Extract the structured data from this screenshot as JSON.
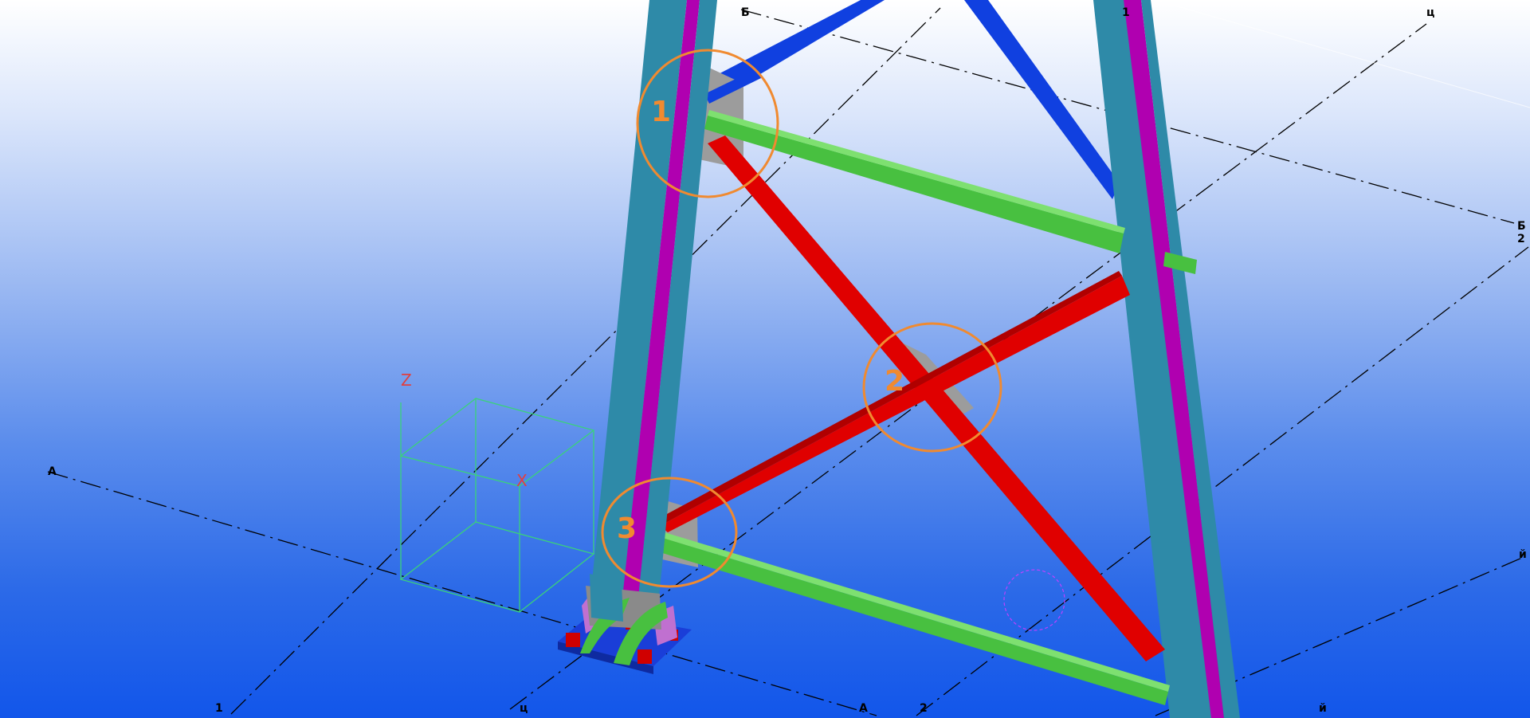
{
  "colors": {
    "background_top": "#ffffff",
    "background_bottom": "#1256ea",
    "column_face": "#2e8aa8",
    "column_web": "#b000b0",
    "brace_red": "#e00000",
    "strut_green": "#48c040",
    "brace_blue": "#1040e0",
    "gusset_plate": "#9c9c9c",
    "base_plate": "#1a3ed8",
    "anchor": "#d00000",
    "stiffener": "#c070d0",
    "callout": "#f08a30",
    "ucs_box": "#3ad27a",
    "ucs_z": "#e04040"
  },
  "grid_labels": {
    "top_b": "Б",
    "top_1": "1",
    "top_c": "ц",
    "right_b": "Б",
    "right_2": "2",
    "right_y": "й",
    "left_a": "А",
    "bottom_1": "1",
    "bottom_c": "ц",
    "bottom_a": "А",
    "bottom_2": "2",
    "bottom_y": "й"
  },
  "ucs": {
    "z_label": "Z",
    "x_label": "X"
  },
  "callouts": [
    {
      "label": "1",
      "icon": "circle-callout"
    },
    {
      "label": "2",
      "icon": "circle-callout"
    },
    {
      "label": "3",
      "icon": "circle-callout"
    }
  ]
}
